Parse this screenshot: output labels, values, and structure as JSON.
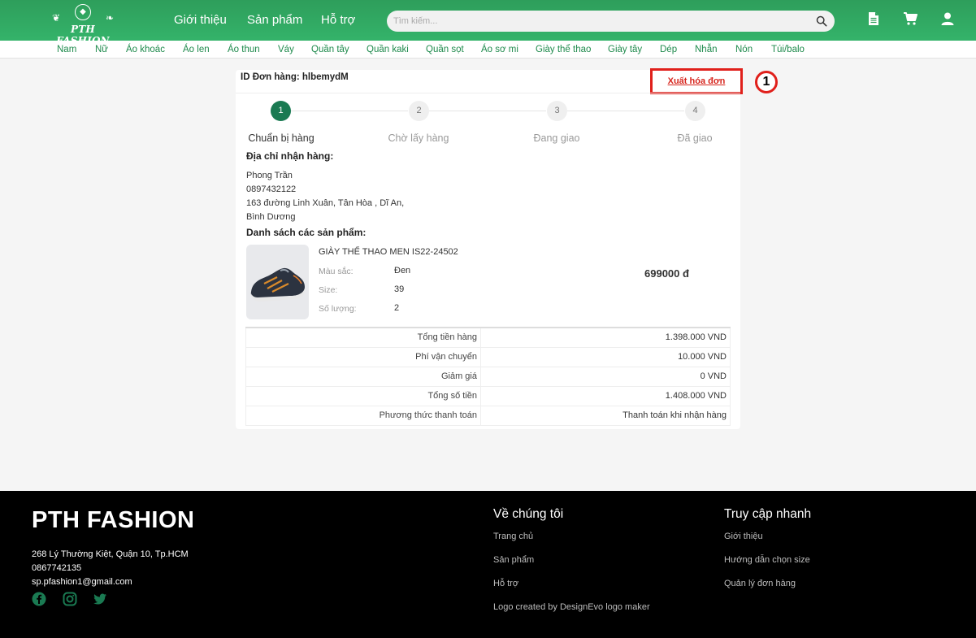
{
  "header": {
    "logo_text": "PTH FASHION",
    "nav": [
      "Giới thiệu",
      "Sản phẩm",
      "Hỗ trợ"
    ],
    "search": {
      "placeholder": "Tìm kiếm...",
      "value": ""
    },
    "icons": [
      "search-icon",
      "document-icon",
      "cart-icon",
      "user-icon"
    ]
  },
  "categories": [
    "Nam",
    "Nữ",
    "Áo khoác",
    "Áo len",
    "Áo thun",
    "Váy",
    "Quần tây",
    "Quần kaki",
    "Quần sọt",
    "Áo sơ mi",
    "Giày thể thao",
    "Giày tây",
    "Dép",
    "Nhẫn",
    "Nón",
    "Túi/balo"
  ],
  "order": {
    "id_label": "ID Đơn hàng: hlbemydM",
    "export_label": "Xuất hóa đơn",
    "marker": "1",
    "steps": [
      {
        "num": "1",
        "label": "Chuẩn bị hàng",
        "active": true
      },
      {
        "num": "2",
        "label": "Chờ lấy hàng",
        "active": false
      },
      {
        "num": "3",
        "label": "Đang giao",
        "active": false
      },
      {
        "num": "4",
        "label": "Đã giao",
        "active": false
      }
    ],
    "address_title": "Địa chỉ nhận hàng:",
    "address": [
      "Phong Trần",
      "0897432122",
      "163 đường Linh Xuân, Tân Hòa , Dĩ An,",
      "Bình Dương"
    ],
    "products_title": "Danh sách các sản phẩm:",
    "product": {
      "name": "GIÀY THỂ THAO MEN IS22-24502",
      "color_label": "Màu sắc:",
      "color_value": "Đen",
      "size_label": "Size:",
      "size_value": "39",
      "qty_label": "Số lượng:",
      "qty_value": "2",
      "price": "699000 đ"
    },
    "summary": [
      {
        "label": "Tổng tiền hàng",
        "value": "1.398.000 VND"
      },
      {
        "label": "Phí vận chuyển",
        "value": "10.000 VND"
      },
      {
        "label": "Giảm giá",
        "value": "0 VND"
      },
      {
        "label": "Tổng số tiền",
        "value": "1.408.000 VND"
      },
      {
        "label": "Phương thức thanh toán",
        "value": "Thanh toán khi nhận hàng"
      }
    ]
  },
  "footer": {
    "brand": "PTH FASHION",
    "address": "268 Lý Thường Kiệt, Quận 10, Tp.HCM",
    "phone": "0867742135",
    "email": "sp.pfashion1@gmail.com",
    "social_icons": [
      "facebook-icon",
      "instagram-icon",
      "twitter-icon"
    ],
    "about_title": "Về chúng tôi",
    "about_links": [
      "Trang chủ",
      "Sản phẩm",
      "Hỗ trợ",
      "Logo created by DesignEvo logo maker"
    ],
    "quick_title": "Truy cập nhanh",
    "quick_links": [
      "Giới thiệu",
      "Hướng dẫn chọn size",
      "Quản lý đơn hàng"
    ]
  },
  "colors": {
    "header_green": "#34b36a",
    "accent_green": "#1a7a52",
    "category_green": "#1e8a4c",
    "highlight_red": "#e0201b"
  }
}
